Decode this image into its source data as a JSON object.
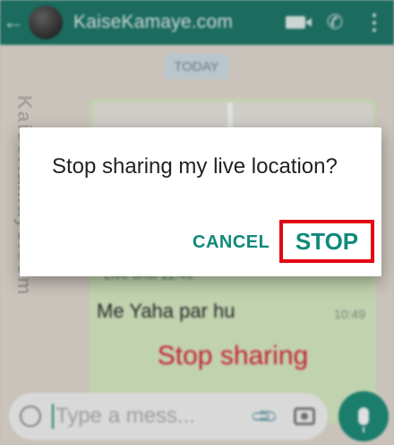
{
  "header": {
    "title": "KaiseKamaye.com",
    "back_icon": "arrow-back-icon",
    "video_icon": "video-call-icon",
    "call_icon": "phone-icon",
    "menu_icon": "more-vert-icon",
    "color": "#1f7a6c"
  },
  "chat": {
    "date_chip": "TODAY",
    "live_text": "Live until 11:49",
    "message": "Me Yaha par hu",
    "message_time": "10:49",
    "stop_sharing_label": "Stop sharing"
  },
  "composer": {
    "placeholder": "Type a mess...",
    "emoji_icon": "emoji-icon",
    "attach_icon": "paperclip-icon",
    "camera_icon": "camera-icon",
    "mic_icon": "mic-icon"
  },
  "watermark": "KaiseKamaye.com",
  "dialog": {
    "message": "Stop sharing my live location?",
    "cancel_label": "CANCEL",
    "stop_label": "STOP",
    "highlight_color": "#e30613",
    "accent_color": "#0f8a7a"
  }
}
